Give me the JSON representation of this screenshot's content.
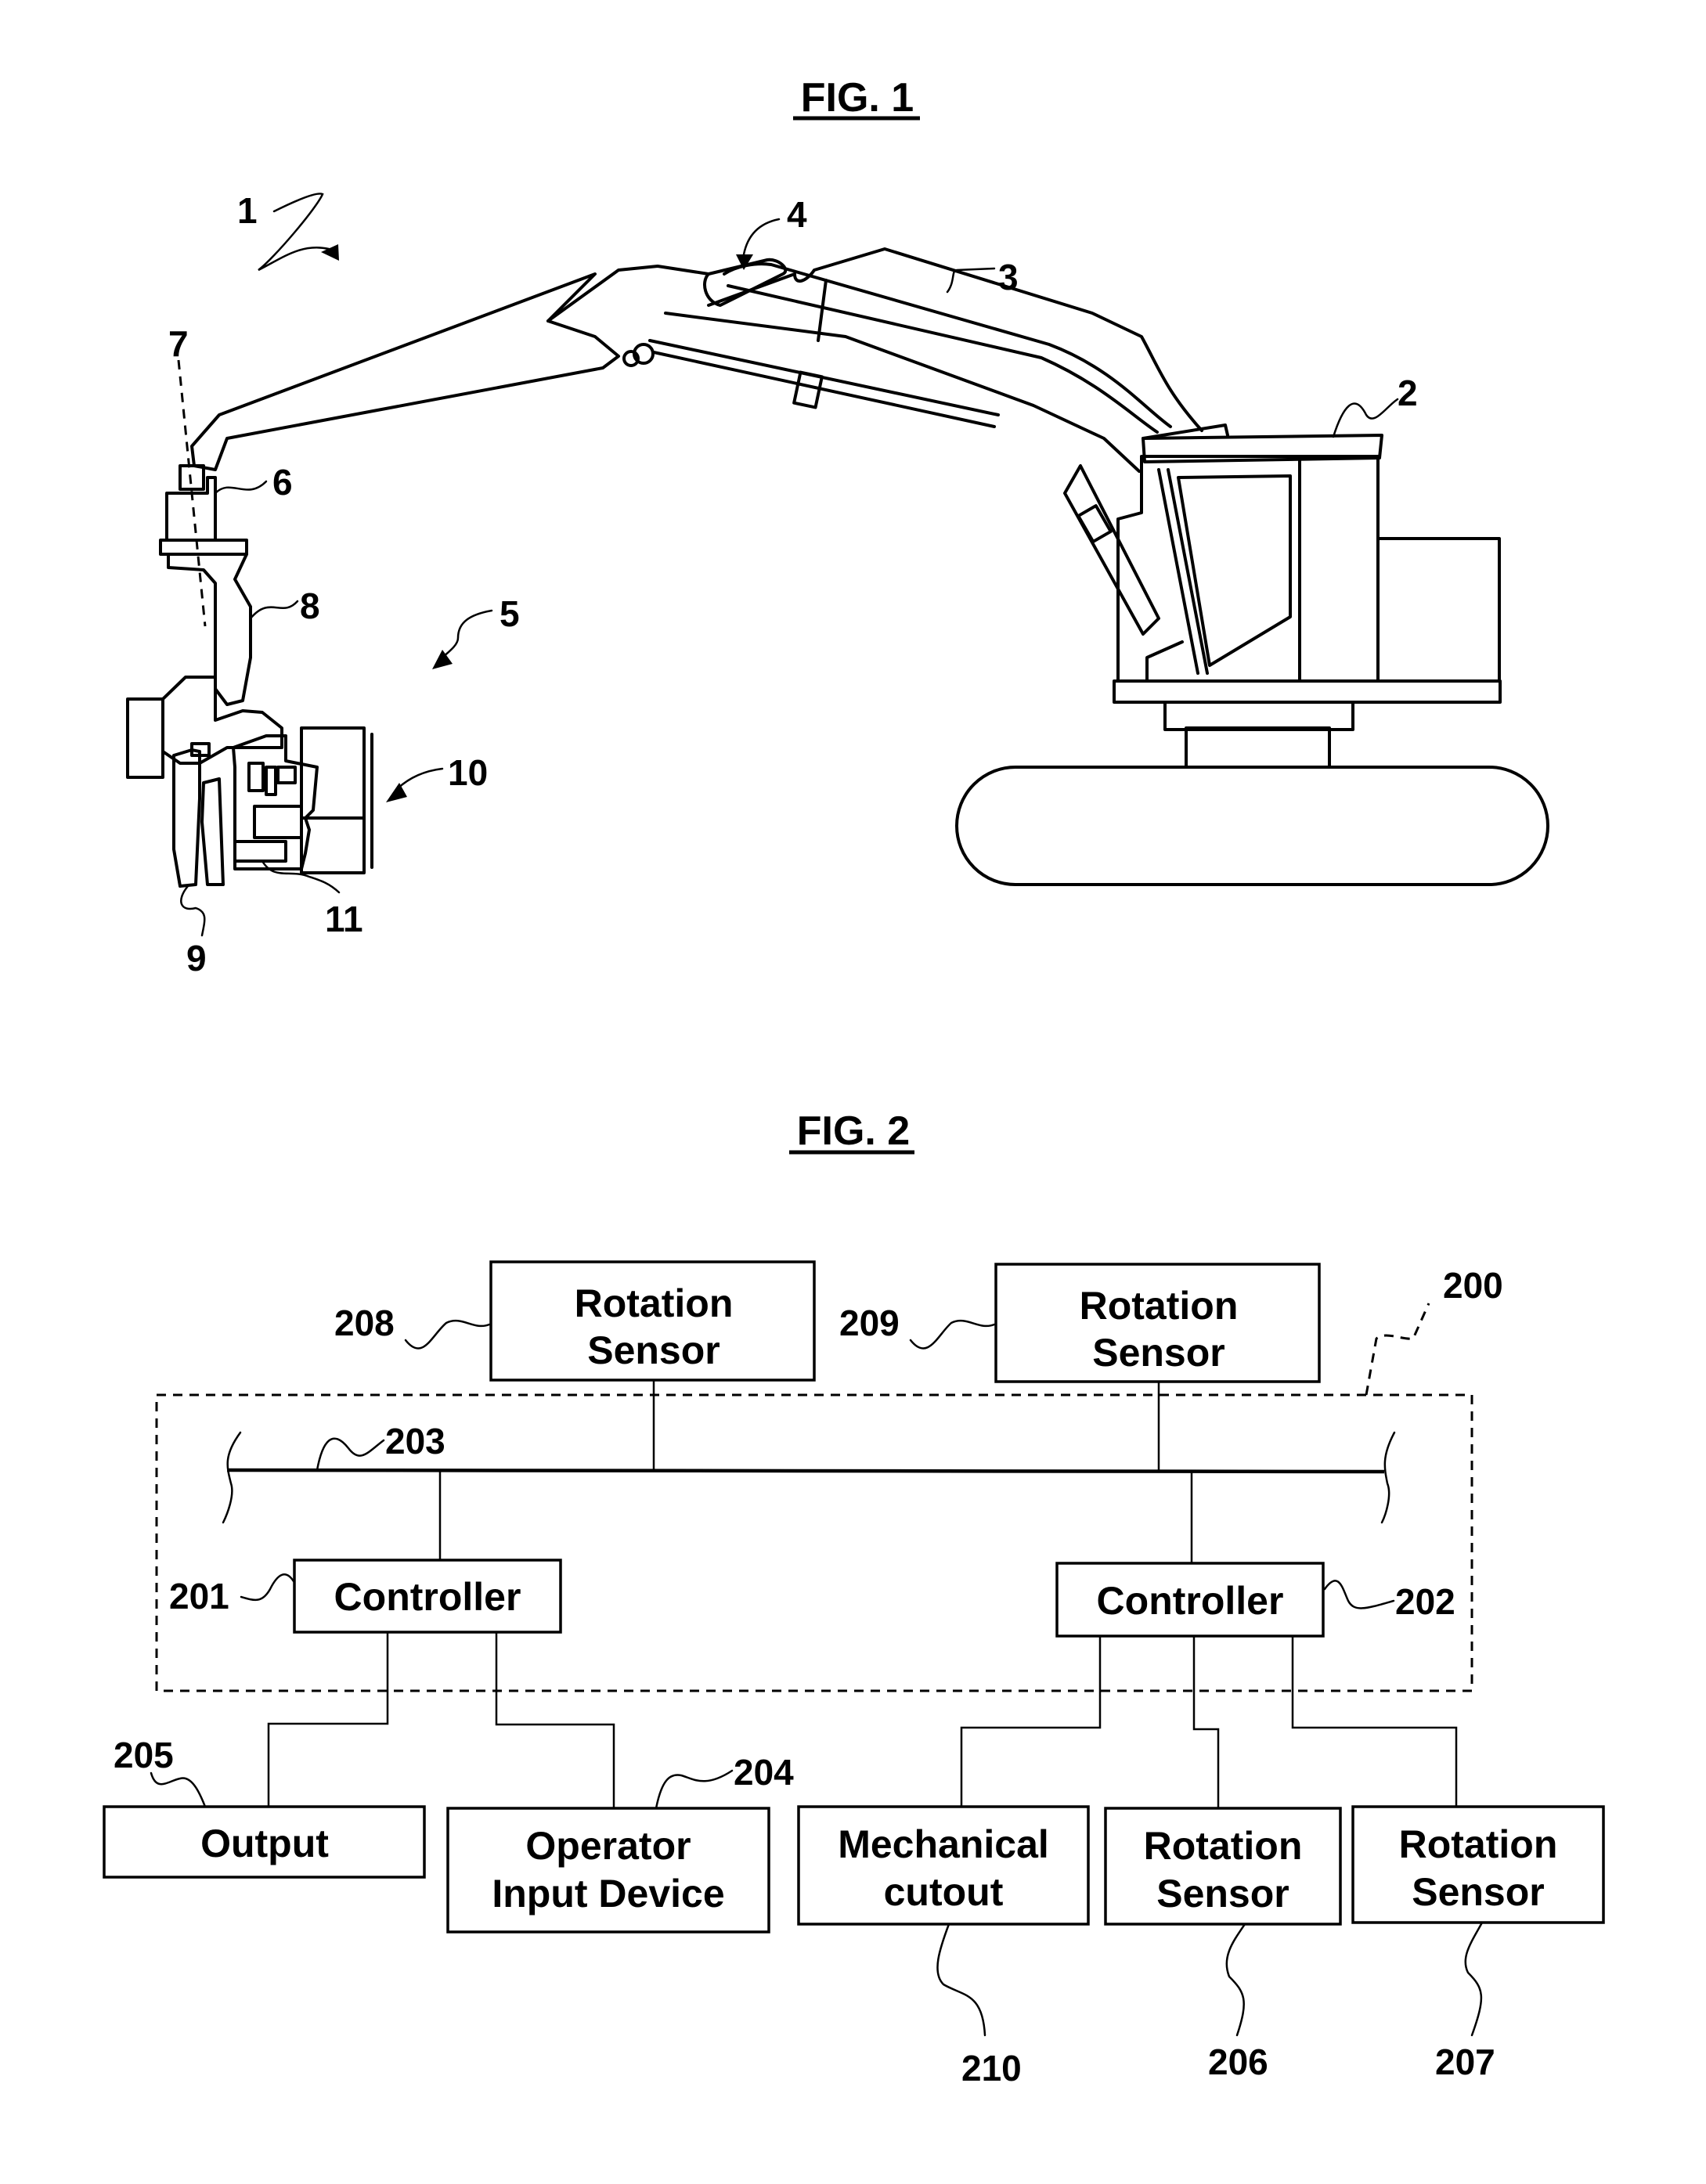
{
  "figure1": {
    "title": "FIG. 1",
    "reference_labels": {
      "machine": "1",
      "cab": "2",
      "boom_hose": "3",
      "boom_joint": "4",
      "felling_head": "5",
      "rotator": "6",
      "rotation_axis": "7",
      "wrist_link": "8",
      "arms": "9",
      "saw_assembly": "10",
      "saw_housing": "11"
    }
  },
  "figure2": {
    "title": "FIG. 2",
    "system_label": "200",
    "bus_label": "203",
    "blocks": {
      "sensor_208": {
        "ref": "208",
        "line1": "Rotation",
        "line2": "Sensor"
      },
      "sensor_209": {
        "ref": "209",
        "line1": "Rotation",
        "line2": "Sensor"
      },
      "controller_201": {
        "ref": "201",
        "text": "Controller"
      },
      "controller_202": {
        "ref": "202",
        "text": "Controller"
      },
      "output_205": {
        "ref": "205",
        "text": "Output"
      },
      "input_204": {
        "ref": "204",
        "line1": "Operator",
        "line2": "Input Device"
      },
      "cutout_210": {
        "ref": "210",
        "line1": "Mechanical",
        "line2": "cutout"
      },
      "sensor_206": {
        "ref": "206",
        "line1": "Rotation",
        "line2": "Sensor"
      },
      "sensor_207": {
        "ref": "207",
        "line1": "Rotation",
        "line2": "Sensor"
      }
    }
  }
}
